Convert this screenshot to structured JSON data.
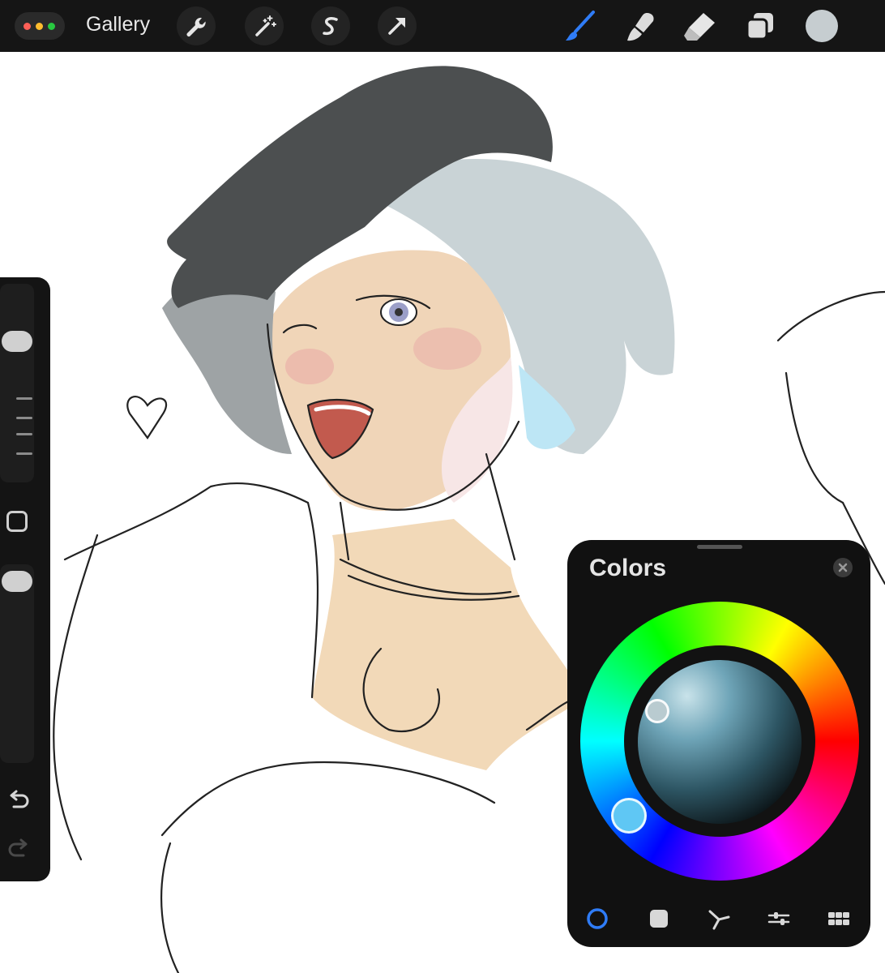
{
  "toolbar": {
    "gallery_label": "Gallery",
    "window_dots": [
      "#ff5f57",
      "#febc2e",
      "#28c840"
    ],
    "left_tools": [
      "wrench-icon",
      "magic-wand-icon",
      "selection-s-icon",
      "arrow-transform-icon"
    ],
    "right_tools": [
      "brush-icon",
      "smudge-icon",
      "eraser-icon",
      "layers-icon"
    ],
    "active_tool": "brush-icon",
    "accent_color": "#2f7cf6",
    "current_color": "#c6cdd0"
  },
  "sidebar": {
    "tools": [
      "brush-size-slider",
      "modify-button",
      "opacity-slider",
      "undo-icon",
      "redo-icon"
    ]
  },
  "colors_panel": {
    "title": "Colors",
    "tabs": [
      "disc-icon",
      "classic-icon",
      "harmony-icon",
      "value-icon",
      "palettes-icon"
    ],
    "active_tab": "disc-icon",
    "hue_handle_color": "#5fc7f4",
    "selected_color": "#b9cbd0"
  }
}
